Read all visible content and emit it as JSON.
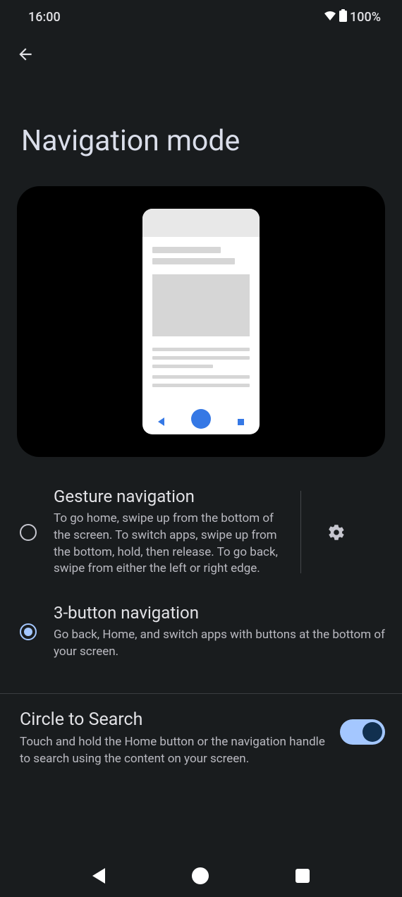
{
  "status": {
    "time": "16:00",
    "battery": "100%"
  },
  "page": {
    "title": "Navigation mode"
  },
  "options": [
    {
      "title": "Gesture navigation",
      "desc": "To go home, swipe up from the bottom of the screen. To switch apps, swipe up from the bottom, hold, then release. To go back, swipe from either the left or right edge.",
      "selected": false,
      "has_settings": true
    },
    {
      "title": "3-button navigation",
      "desc": "Go back, Home, and switch apps with buttons at the bottom of your screen.",
      "selected": true,
      "has_settings": false
    }
  ],
  "circle_to_search": {
    "title": "Circle to Search",
    "desc": "Touch and hold the Home button or the navigation handle to search using the content on your screen.",
    "enabled": true
  }
}
